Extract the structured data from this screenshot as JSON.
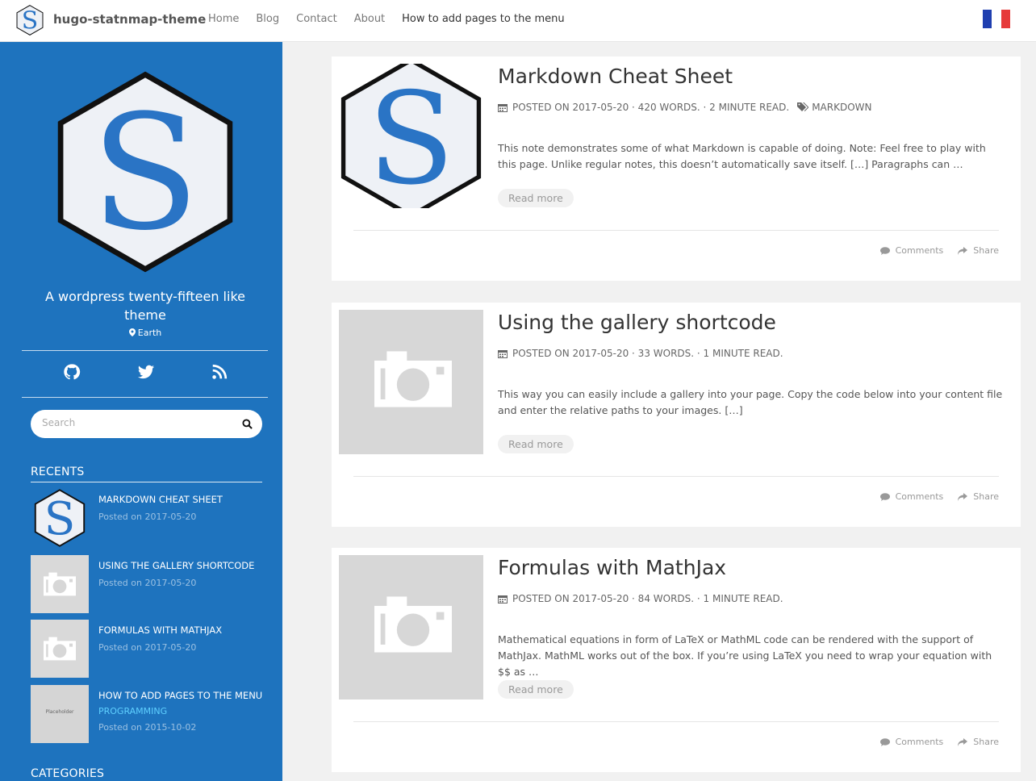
{
  "brand": {
    "title": "hugo-statnmap-theme"
  },
  "nav": {
    "items": [
      "Home",
      "Blog",
      "Contact",
      "About",
      "How to add pages to the menu"
    ]
  },
  "colors": {
    "sidebar": "#1e73be",
    "logo_blue": "#2a74c5",
    "flag_blue": "#1f3fb0",
    "flag_red": "#e63a3a"
  },
  "sidebar": {
    "tagline": "A wordpress twenty-fifteen like theme",
    "location": "Earth",
    "socials": [
      "github-icon",
      "twitter-icon",
      "rss-icon"
    ],
    "search": {
      "placeholder": "Search"
    },
    "recents_title": "RECENTS",
    "categories_title": "CATEGORIES",
    "recents": [
      {
        "title": "MARKDOWN CHEAT SHEET",
        "date": "Posted on 2017-05-20",
        "thumb": "logo"
      },
      {
        "title": "USING THE GALLERY SHORTCODE",
        "date": "Posted on 2017-05-20",
        "thumb": "camera"
      },
      {
        "title": "FORMULAS WITH MATHJAX",
        "date": "Posted on 2017-05-20",
        "thumb": "camera"
      },
      {
        "title": "HOW TO ADD PAGES TO THE MENU",
        "tag": "PROGRAMMING",
        "date": "Posted on 2015-10-02",
        "thumb": "placeholder",
        "thumb_text": "Placeholder"
      }
    ]
  },
  "posts": [
    {
      "title": "Markdown Cheat Sheet",
      "meta": "POSTED ON 2017-05-20 · 420 WORDS. · 2 MINUTE READ.",
      "tag": "MARKDOWN",
      "excerpt": "This note demonstrates some of what Markdown is capable of doing. Note: Feel free to play with this page. Unlike regular notes, this doesn’t automatically save itself. […] Paragraphs can …",
      "read_more": "Read more",
      "comments": "Comments",
      "share": "Share"
    },
    {
      "title": "Using the gallery shortcode",
      "meta": "POSTED ON 2017-05-20 · 33 WORDS. · 1 MINUTE READ.",
      "excerpt": "This way you can easily include a gallery into your page. Copy the code below into your content file and enter the relative paths to your images. […]",
      "read_more": "Read more",
      "comments": "Comments",
      "share": "Share"
    },
    {
      "title": "Formulas with MathJax",
      "meta": "POSTED ON 2017-05-20 · 84 WORDS. · 1 MINUTE READ.",
      "excerpt": "Mathematical equations in form of LaTeX or MathML code can be rendered with the support of MathJax. MathML works out of the box. If you’re using LaTeX you need to wrap your equation with $$ as …",
      "read_more": "Read more",
      "comments": "Comments",
      "share": "Share"
    }
  ]
}
